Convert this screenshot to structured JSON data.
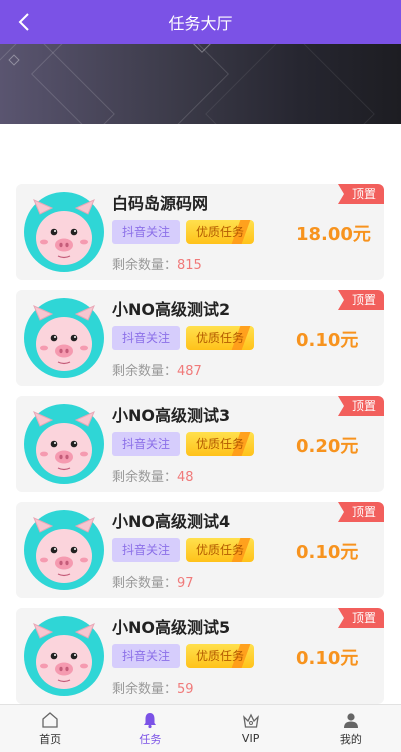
{
  "header": {
    "title": "任务大厅"
  },
  "tasks": [
    {
      "name": "白码岛源码网",
      "tag_platform": "抖音关注",
      "tag_quality": "优质任务",
      "remain_label": "剩余数量：",
      "remain_count": "815",
      "price": "18.00元",
      "badge": "顶置"
    },
    {
      "name": "小NO高级测试2",
      "tag_platform": "抖音关注",
      "tag_quality": "优质任务",
      "remain_label": "剩余数量：",
      "remain_count": "487",
      "price": "0.10元",
      "badge": "顶置"
    },
    {
      "name": "小NO高级测试3",
      "tag_platform": "抖音关注",
      "tag_quality": "优质任务",
      "remain_label": "剩余数量：",
      "remain_count": "48",
      "price": "0.20元",
      "badge": "顶置"
    },
    {
      "name": "小NO高级测试4",
      "tag_platform": "抖音关注",
      "tag_quality": "优质任务",
      "remain_label": "剩余数量：",
      "remain_count": "97",
      "price": "0.10元",
      "badge": "顶置"
    },
    {
      "name": "小NO高级测试5",
      "tag_platform": "抖音关注",
      "tag_quality": "优质任务",
      "remain_label": "剩余数量：",
      "remain_count": "59",
      "price": "0.10元",
      "badge": "顶置"
    }
  ],
  "tabbar": {
    "items": [
      {
        "label": "首页",
        "icon": "home-icon",
        "active": false
      },
      {
        "label": "任务",
        "icon": "bell-icon",
        "active": true
      },
      {
        "label": "VIP",
        "icon": "crown-icon",
        "active": false
      },
      {
        "label": "我的",
        "icon": "user-icon",
        "active": false
      }
    ]
  },
  "colors": {
    "brand": "#7b52e6",
    "price": "#f7931e",
    "badge": "#f25f5c",
    "count": "#f07a7a"
  }
}
